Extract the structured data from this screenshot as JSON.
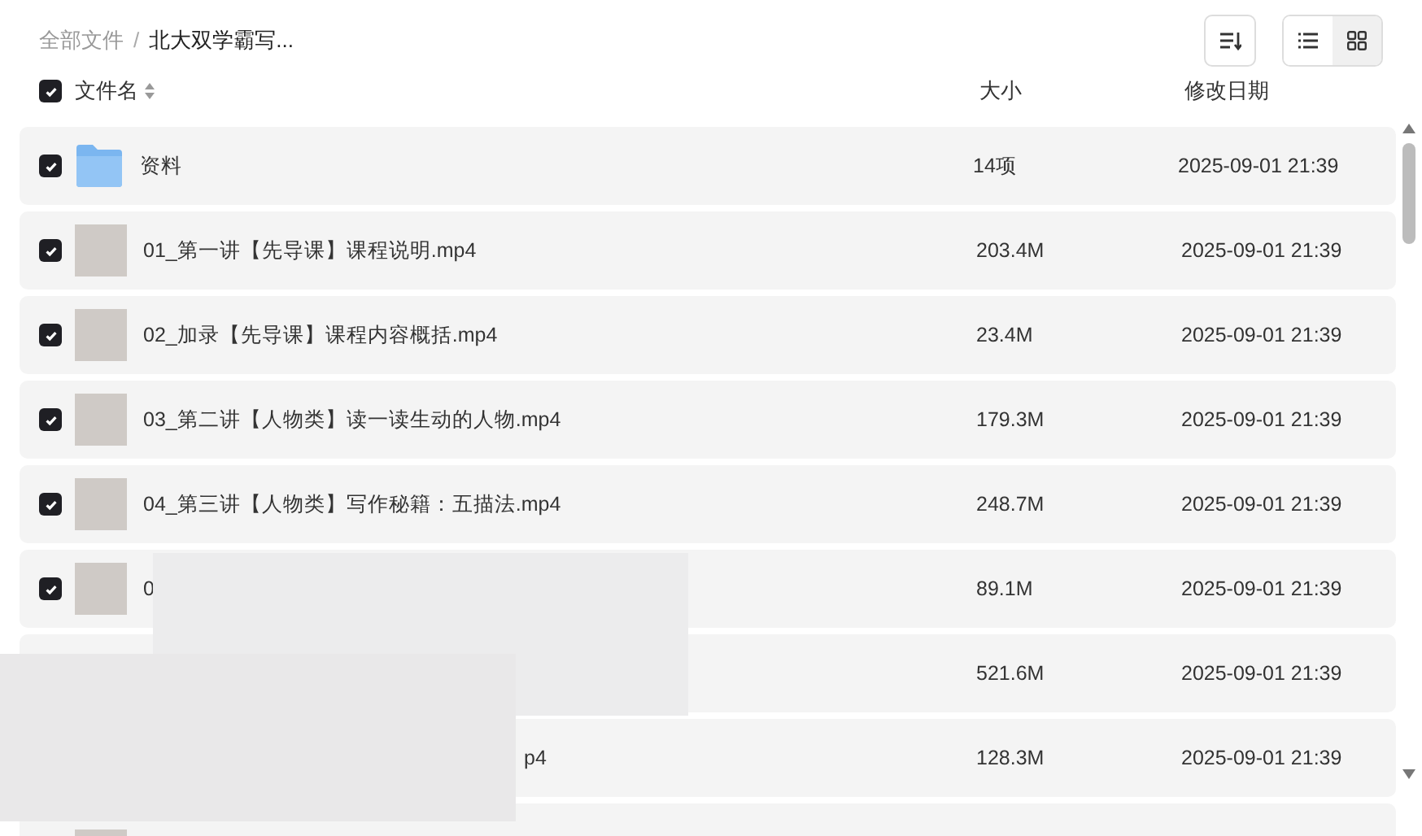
{
  "breadcrumb_separator": "/",
  "breadcrumb": [
    {
      "label": "全部文件",
      "current": false
    },
    {
      "label": "北大双学霸写...",
      "current": true
    }
  ],
  "view_modes": [
    {
      "kind": "list",
      "selected": false
    },
    {
      "kind": "grid",
      "selected": true
    }
  ],
  "header": {
    "checked": true,
    "name": "文件名",
    "size": "大小",
    "date": "修改日期"
  },
  "rows": [
    {
      "kind": "folder",
      "checked": true,
      "name": "资料",
      "size": "14项",
      "date": "2025-09-01 21:39"
    },
    {
      "kind": "video",
      "checked": true,
      "name": "01_第一讲【先导课】课程说明.mp4",
      "size": "203.4M",
      "date": "2025-09-01 21:39"
    },
    {
      "kind": "video",
      "checked": true,
      "name": "02_加录【先导课】课程内容概括.mp4",
      "size": "23.4M",
      "date": "2025-09-01 21:39"
    },
    {
      "kind": "video",
      "checked": true,
      "name": "03_第二讲【人物类】读一读生动的人物.mp4",
      "size": "179.3M",
      "date": "2025-09-01 21:39"
    },
    {
      "kind": "video",
      "checked": true,
      "name": "04_第三讲【人物类】写作秘籍：五描法.mp4",
      "size": "248.7M",
      "date": "2025-09-01 21:39"
    },
    {
      "kind": "video",
      "checked": true,
      "name": "0",
      "size": "89.1M",
      "date": "2025-09-01 21:39"
    },
    {
      "kind": "hidden",
      "size": "521.6M",
      "date": "2025-09-01 21:39"
    },
    {
      "kind": "tail",
      "name": "p4",
      "size": "128.3M",
      "date": "2025-09-01 21:39"
    },
    {
      "kind": "cut"
    }
  ]
}
